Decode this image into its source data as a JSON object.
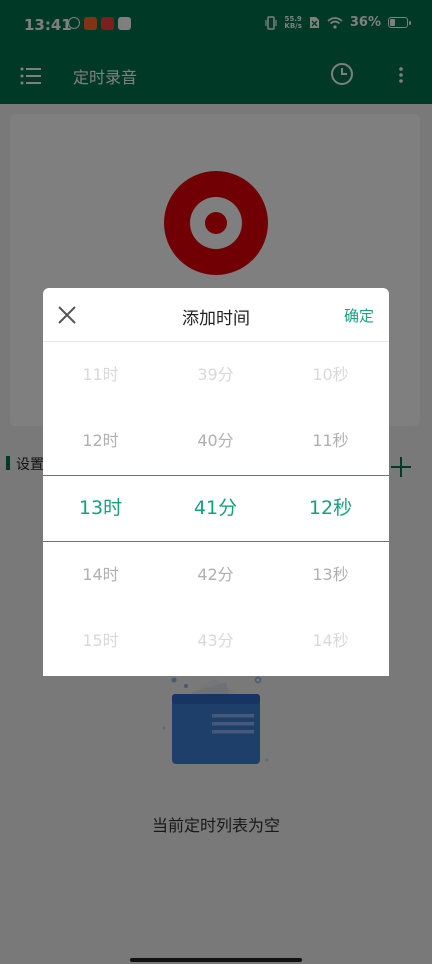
{
  "status_bar": {
    "time": "13:41",
    "net_speed_value": "55.9",
    "net_speed_unit": "KB/s",
    "battery": "36%",
    "battery_level": 0.36
  },
  "app_bar": {
    "title": "定时录音",
    "icons": [
      "list-menu-icon",
      "clock-icon",
      "more-vert-icon"
    ]
  },
  "main": {
    "section_label": "设置",
    "empty_text": "当前定时列表为空"
  },
  "dialog": {
    "title": "添加时间",
    "confirm_label": "确定",
    "hours": [
      "11时",
      "12时",
      "13时",
      "14时",
      "15时"
    ],
    "minutes": [
      "39分",
      "40分",
      "41分",
      "42分",
      "43分"
    ],
    "seconds": [
      "10秒",
      "11秒",
      "12秒",
      "13秒",
      "14秒"
    ]
  },
  "colors": {
    "primary": "#00754f",
    "accent": "#13a27e",
    "record": "#e3000b"
  }
}
